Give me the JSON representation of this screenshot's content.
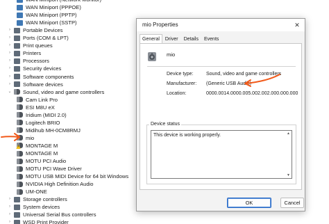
{
  "tree": [
    {
      "label": "WAN Miniport (Network Monitor)",
      "indent": 2,
      "icon": "network-adapter-icon",
      "chevron": ""
    },
    {
      "label": "WAN Miniport (PPPOE)",
      "indent": 2,
      "icon": "network-adapter-icon",
      "chevron": ""
    },
    {
      "label": "WAN Miniport (PPTP)",
      "indent": 2,
      "icon": "network-adapter-icon",
      "chevron": ""
    },
    {
      "label": "WAN Miniport (SSTP)",
      "indent": 2,
      "icon": "network-adapter-icon",
      "chevron": ""
    },
    {
      "label": "Portable Devices",
      "indent": 1,
      "icon": "portable-device-icon",
      "chevron": "›"
    },
    {
      "label": "Ports (COM & LPT)",
      "indent": 1,
      "icon": "port-icon",
      "chevron": "›"
    },
    {
      "label": "Print queues",
      "indent": 1,
      "icon": "printer-icon",
      "chevron": "›"
    },
    {
      "label": "Printers",
      "indent": 1,
      "icon": "printer-icon",
      "chevron": "›"
    },
    {
      "label": "Processors",
      "indent": 1,
      "icon": "processor-icon",
      "chevron": "›"
    },
    {
      "label": "Security devices",
      "indent": 1,
      "icon": "security-device-icon",
      "chevron": "›"
    },
    {
      "label": "Software components",
      "indent": 1,
      "icon": "software-component-icon",
      "chevron": "›"
    },
    {
      "label": "Software devices",
      "indent": 1,
      "icon": "software-device-icon",
      "chevron": "›"
    },
    {
      "label": "Sound, video and game controllers",
      "indent": 1,
      "icon": "speaker-icon",
      "chevron": "⌄"
    },
    {
      "label": "Cam Link Pro",
      "indent": 2,
      "icon": "speaker-icon",
      "chevron": ""
    },
    {
      "label": "ESI M8U eX",
      "indent": 2,
      "icon": "speaker-icon",
      "chevron": ""
    },
    {
      "label": "Iridium (MIDI 2.0)",
      "indent": 2,
      "icon": "speaker-icon",
      "chevron": ""
    },
    {
      "label": "Logitech BRIO",
      "indent": 2,
      "icon": "speaker-icon",
      "chevron": ""
    },
    {
      "label": "Midihub MH-0CM8RMJ",
      "indent": 2,
      "icon": "speaker-icon",
      "chevron": ""
    },
    {
      "label": "mio",
      "indent": 2,
      "icon": "speaker-icon",
      "chevron": ""
    },
    {
      "label": "MONTAGE M",
      "indent": 2,
      "icon": "warning-device-icon",
      "chevron": ""
    },
    {
      "label": "MONTAGE M",
      "indent": 2,
      "icon": "speaker-icon",
      "chevron": ""
    },
    {
      "label": "MOTU PCI Audio",
      "indent": 2,
      "icon": "speaker-icon",
      "chevron": ""
    },
    {
      "label": "MOTU PCI Wave Driver",
      "indent": 2,
      "icon": "speaker-icon",
      "chevron": ""
    },
    {
      "label": "MOTU USB MIDI Device for 64 bit Windows",
      "indent": 2,
      "icon": "speaker-icon",
      "chevron": ""
    },
    {
      "label": "NVIDIA High Definition Audio",
      "indent": 2,
      "icon": "speaker-icon",
      "chevron": ""
    },
    {
      "label": "UM-ONE",
      "indent": 2,
      "icon": "speaker-icon",
      "chevron": ""
    },
    {
      "label": "Storage controllers",
      "indent": 1,
      "icon": "storage-controller-icon",
      "chevron": "›"
    },
    {
      "label": "System devices",
      "indent": 1,
      "icon": "system-device-icon",
      "chevron": "›"
    },
    {
      "label": "Universal Serial Bus controllers",
      "indent": 1,
      "icon": "usb-controller-icon",
      "chevron": "›"
    },
    {
      "label": "WSD Print Provider",
      "indent": 1,
      "icon": "printer-icon",
      "chevron": "›"
    }
  ],
  "dialog": {
    "title": "mio Properties",
    "close_glyph": "✕",
    "tabs": [
      "General",
      "Driver",
      "Details",
      "Events"
    ],
    "active_tab": "General",
    "device_name": "mio",
    "props": [
      {
        "label": "Device type:",
        "value": "Sound, video and game controllers"
      },
      {
        "label": "Manufacturer:",
        "value": "(Generic USB Audio)"
      },
      {
        "label": "Location:",
        "value": "0000.0014.0000.005.002.002.000.000.000"
      }
    ],
    "status_legend": "Device status",
    "status_text": "This device is working properly.",
    "ok_label": "OK",
    "cancel_label": "Cancel"
  },
  "colors": {
    "annotation": "#f25a1a",
    "accent": "#2a6cc8"
  }
}
